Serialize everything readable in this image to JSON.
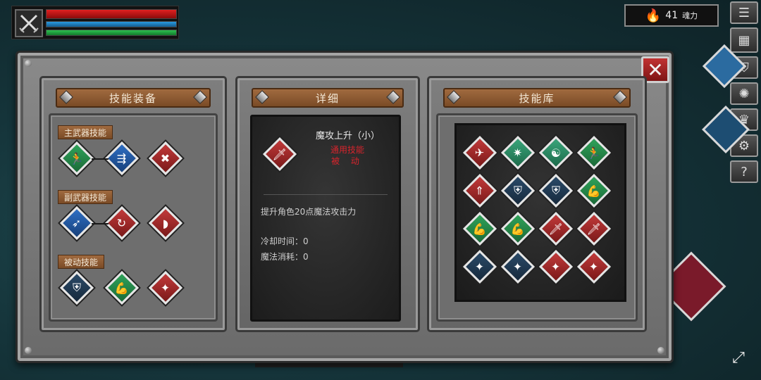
{
  "hud": {
    "hp_fraction": 1.0,
    "mp_fraction": 1.0,
    "sp_fraction": 1.0,
    "weapon_icon": "crossed-swords-icon"
  },
  "soul": {
    "value": "41",
    "label": "魂力",
    "icon": "flame-icon"
  },
  "side_menu": [
    {
      "name": "menu-list-icon",
      "glyph": "☰"
    },
    {
      "name": "scroll-icon",
      "glyph": "▦"
    },
    {
      "name": "helmet-icon",
      "glyph": "⛨"
    },
    {
      "name": "medallion-icon",
      "glyph": "✺"
    },
    {
      "name": "crown-icon",
      "glyph": "♛"
    },
    {
      "name": "settings-gear-icon",
      "glyph": "⚙"
    },
    {
      "name": "help-icon",
      "glyph": "?"
    }
  ],
  "panels": {
    "equip": {
      "title": "技能装备",
      "main_weapon_label": "主武器技能",
      "sub_weapon_label": "副武器技能",
      "passive_label": "被动技能"
    },
    "detail": {
      "title": "详细",
      "skill_name": "魔攻上升（小）",
      "skill_type": "通用技能",
      "skill_mode": "被 动",
      "description": "提升角色20点魔法攻击力",
      "cooldown": "冷却时间：0",
      "mana_cost": "魔法消耗：0"
    },
    "library": {
      "title": "技能库"
    }
  },
  "skills": {
    "main": [
      {
        "name": "dash-skill-icon",
        "color": "green",
        "glyph": "🏃"
      },
      {
        "name": "slide-skill-icon",
        "color": "blue",
        "glyph": "⇶"
      },
      {
        "name": "cross-slash-skill-icon",
        "color": "red",
        "glyph": "✖"
      }
    ],
    "sub": [
      {
        "name": "charge-skill-icon",
        "color": "blue",
        "glyph": "➶"
      },
      {
        "name": "whirlwind-skill-icon",
        "color": "red",
        "glyph": "↻"
      },
      {
        "name": "crescent-slash-skill-icon",
        "color": "red",
        "glyph": "◗"
      }
    ],
    "passive": [
      {
        "name": "shield-skill-icon",
        "color": "navy",
        "glyph": "⛨"
      },
      {
        "name": "muscle-skill-icon",
        "color": "green",
        "glyph": "💪"
      },
      {
        "name": "magic-sword-skill-icon",
        "color": "red",
        "glyph": "✦"
      }
    ],
    "detail_icon": {
      "name": "magic-sword-skill-icon",
      "color": "red",
      "glyph": "🗡"
    },
    "library": [
      {
        "name": "flying-kick-skill-icon",
        "color": "red",
        "glyph": "✈"
      },
      {
        "name": "burst-skill-icon",
        "color": "teal",
        "glyph": "✷"
      },
      {
        "name": "mind-skill-icon",
        "color": "teal",
        "glyph": "☯"
      },
      {
        "name": "dash-skill-icon",
        "color": "green",
        "glyph": "🏃"
      },
      {
        "name": "rank-up-skill-icon",
        "color": "red",
        "glyph": "⇑"
      },
      {
        "name": "shield-skill-icon",
        "color": "navy",
        "glyph": "⛨"
      },
      {
        "name": "shield-skill-icon",
        "color": "navy",
        "glyph": "⛨"
      },
      {
        "name": "muscle-skill-icon",
        "color": "green",
        "glyph": "💪"
      },
      {
        "name": "muscle-skill-icon",
        "color": "green",
        "glyph": "💪"
      },
      {
        "name": "muscle-skill-icon",
        "color": "green",
        "glyph": "💪"
      },
      {
        "name": "magic-sword-skill-icon",
        "color": "red",
        "glyph": "🗡"
      },
      {
        "name": "magic-sword-skill-icon",
        "color": "red",
        "glyph": "🗡"
      },
      {
        "name": "magic-shield-skill-icon",
        "color": "navy",
        "glyph": "✦"
      },
      {
        "name": "magic-shield-skill-icon",
        "color": "navy",
        "glyph": "✦"
      },
      {
        "name": "magic-sword-skill-icon",
        "color": "red",
        "glyph": "✦"
      },
      {
        "name": "magic-sword-skill-icon",
        "color": "red",
        "glyph": "✦"
      }
    ]
  }
}
